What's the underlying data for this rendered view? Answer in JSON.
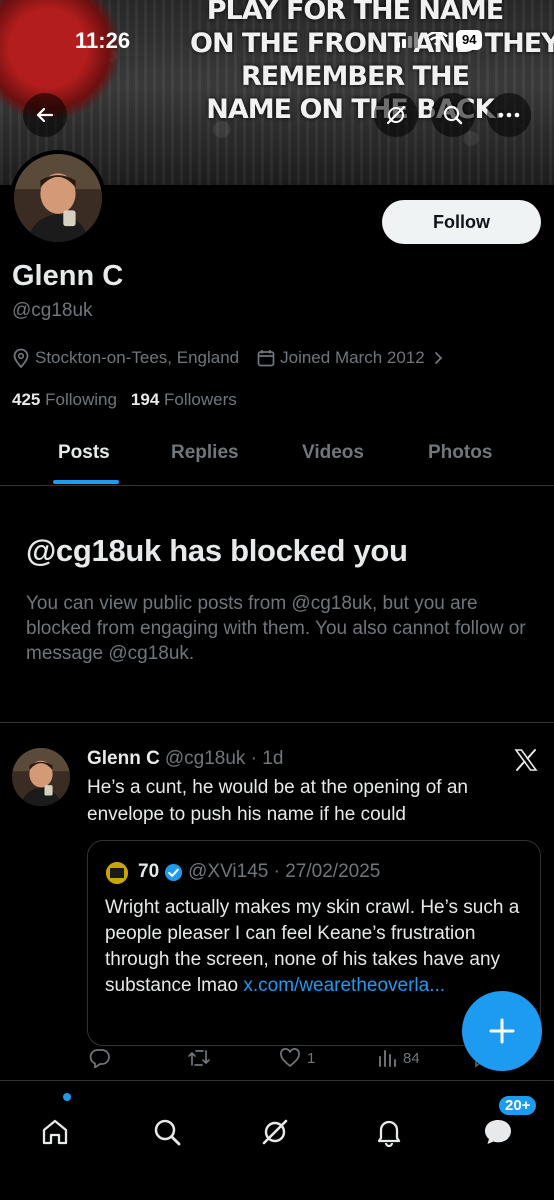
{
  "status_bar": {
    "time": "11:26",
    "battery": "94"
  },
  "banner": {
    "quote_lines": [
      "PLAY FOR THE NAME",
      "ON THE FRONT AND THEY'LL",
      "REMEMBER THE",
      "NAME ON THE BACK."
    ]
  },
  "top_nav": {
    "icons": [
      "back-arrow-icon",
      "grok-icon",
      "search-icon",
      "more-icon"
    ]
  },
  "profile": {
    "display_name": "Glenn C",
    "handle": "@cg18uk",
    "follow_label": "Follow",
    "location": "Stockton-on-Tees, England",
    "joined": "Joined March 2012",
    "following_count": "425",
    "following_label": "Following",
    "followers_count": "194",
    "followers_label": "Followers"
  },
  "tabs": [
    {
      "label": "Posts",
      "active": true
    },
    {
      "label": "Replies",
      "active": false
    },
    {
      "label": "Videos",
      "active": false
    },
    {
      "label": "Photos",
      "active": false
    }
  ],
  "blocked": {
    "title": "@cg18uk has blocked you",
    "body": "You can view public posts from @cg18uk, but you are blocked from engaging with them. You also cannot follow or message @cg18uk."
  },
  "post": {
    "name": "Glenn C",
    "handle_time": "@cg18uk · 1d",
    "text": "He’s a cunt, he would be at the opening of an envelope to push his name if he could",
    "quote": {
      "name": "70",
      "handle_time": "@XVi145 · 27/02/2025",
      "text": "Wright actually makes my skin crawl. He’s such a people pleaser I can feel Keane’s frustration through the screen, none of his takes have any substance lmao ",
      "link": "x.com/wearetheoverla..."
    },
    "actions": {
      "likes": "1",
      "views": "84"
    }
  },
  "bottom_nav": {
    "badge": "20+"
  },
  "colors": {
    "accent": "#1d9bf0",
    "background": "#000000",
    "muted": "#71767b",
    "text": "#e7e9ea"
  }
}
